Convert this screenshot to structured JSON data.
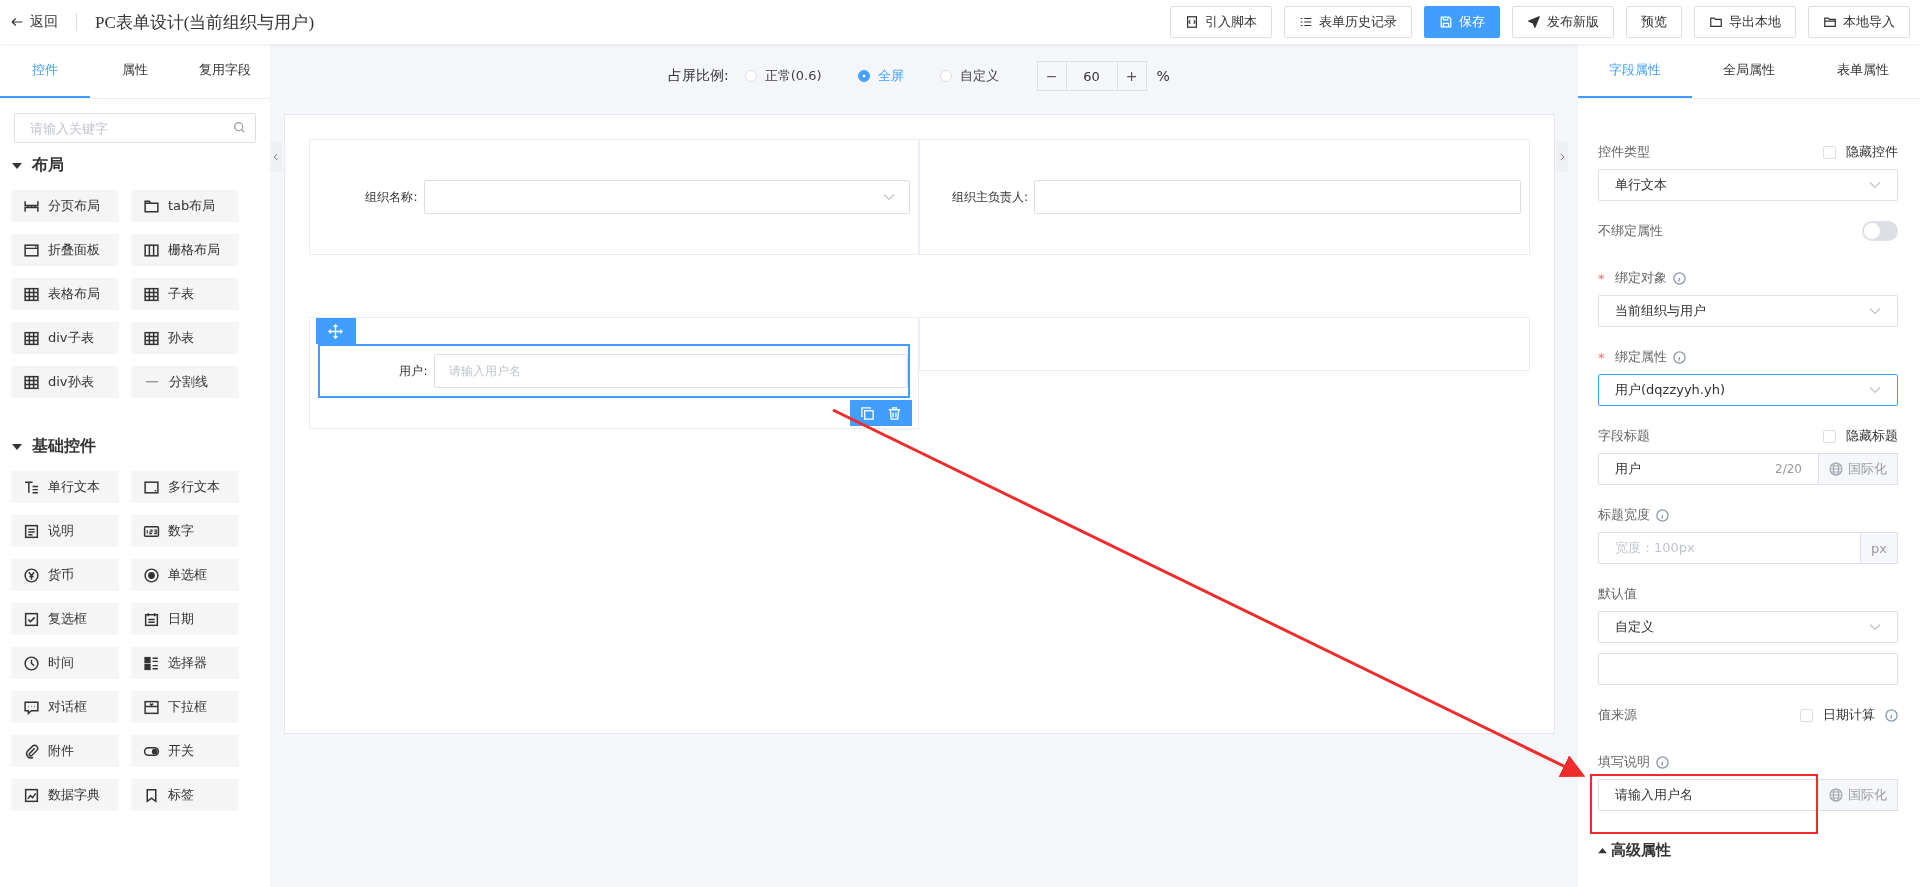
{
  "header": {
    "back": "返回",
    "title": "PC表单设计(当前组织与用户)",
    "buttons": [
      {
        "label": "引入脚本",
        "kind": "default"
      },
      {
        "label": "表单历史记录",
        "kind": "default"
      },
      {
        "label": "保存",
        "kind": "primary"
      },
      {
        "label": "发布新版",
        "kind": "default"
      },
      {
        "label": "预览",
        "kind": "plain"
      },
      {
        "label": "导出本地",
        "kind": "default"
      },
      {
        "label": "本地导入",
        "kind": "default"
      }
    ]
  },
  "left_panel": {
    "tabs": [
      {
        "label": "控件",
        "selected": true
      },
      {
        "label": "属性",
        "selected": false
      },
      {
        "label": "复用字段",
        "selected": false
      }
    ],
    "search": {
      "placeholder": "请输入关键字"
    },
    "groups": [
      {
        "title": "布局",
        "expanded": true,
        "items": [
          "分页布局",
          "tab布局",
          "折叠面板",
          "栅格布局",
          "表格布局",
          "子表",
          "div子表",
          "孙表",
          "div孙表",
          "分割线"
        ]
      },
      {
        "title": "基础控件",
        "expanded": true,
        "items": [
          "单行文本",
          "多行文本",
          "说明",
          "数字",
          "货币",
          "单选框",
          "复选框",
          "日期",
          "时间",
          "选择器",
          "对话框",
          "下拉框",
          "附件",
          "开关",
          "数据字典",
          "标签"
        ]
      }
    ]
  },
  "canvas": {
    "ratio": {
      "label": "占屏比例:",
      "options": [
        {
          "label": "正常(0.6)",
          "selected": false
        },
        {
          "label": "全屏",
          "selected": true
        },
        {
          "label": "自定义",
          "selected": false
        }
      ],
      "stepper": {
        "minus": "−",
        "value": "60",
        "plus": "+",
        "unit": "%"
      }
    },
    "rows": [
      {
        "cells": [
          {
            "kind": "select",
            "label": "组织名称:"
          },
          {
            "kind": "input",
            "label": "组织主负责人:"
          }
        ]
      },
      {
        "cells": [
          {
            "kind": "input",
            "label": "用户:",
            "placeholder": "请输入用户名",
            "selected": true
          },
          {
            "kind": "empty"
          }
        ]
      }
    ]
  },
  "right_panel": {
    "tabs": [
      {
        "label": "字段属性",
        "selected": true
      },
      {
        "label": "全局属性",
        "selected": false
      },
      {
        "label": "表单属性",
        "selected": false
      }
    ],
    "fields": [
      {
        "kind": "select",
        "label": "控件类型",
        "check": {
          "label": "隐藏控件",
          "checked": false
        },
        "value": "单行文本"
      },
      {
        "kind": "switch",
        "label": "不绑定属性",
        "on": false
      },
      {
        "kind": "select",
        "label": "绑定对象",
        "required_mark": "*",
        "info": true,
        "value": "当前组织与用户"
      },
      {
        "kind": "select",
        "label": "绑定属性",
        "required_mark": "*",
        "info": true,
        "value": "用户(dqzzyyh.yh)",
        "focused": true
      },
      {
        "kind": "addon",
        "label": "字段标题",
        "check": {
          "label": "隐藏标题",
          "checked": false
        },
        "value": "用户",
        "count": "2/20",
        "addon": "国际化"
      },
      {
        "kind": "addon",
        "label": "标题宽度",
        "info": true,
        "placeholder": "宽度：100px",
        "addon": "px"
      },
      {
        "kind": "select_input",
        "label": "默认值",
        "value": "自定义"
      },
      {
        "kind": "label",
        "label": "值来源",
        "check": {
          "label": "日期计算",
          "checked": false,
          "info": true
        }
      },
      {
        "kind": "addon",
        "label": "填写说明",
        "info": true,
        "value": "请输入用户名",
        "addon": "国际化",
        "highlighted": true
      }
    ],
    "advanced": {
      "label": "高级属性",
      "expanded": false
    }
  }
}
